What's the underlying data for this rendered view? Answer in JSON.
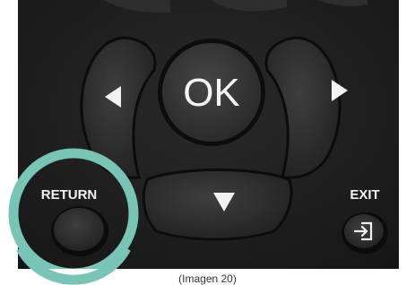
{
  "photo": {
    "ok_label": "OK",
    "return_label": "RETURN",
    "exit_label": "EXIT",
    "highlight_color": "#79c3b7",
    "icons": [
      "arrow-left-icon",
      "arrow-right-icon",
      "arrow-down-icon",
      "exit-icon"
    ]
  },
  "caption": "(Imagen 20)"
}
